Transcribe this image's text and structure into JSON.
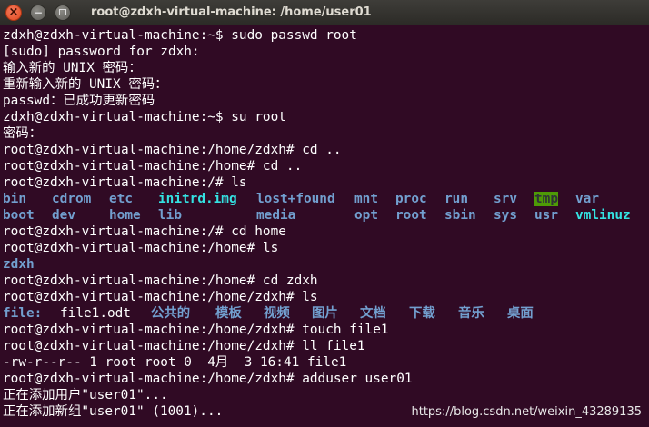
{
  "titlebar": {
    "title": "root@zdxh-virtual-machine: /home/user01",
    "close_glyph": "×",
    "minimize_glyph": "−"
  },
  "colors": {
    "background": "#300a24",
    "text": "#ffffff",
    "directory": "#729fcf",
    "symlink": "#34e2e2",
    "sticky_bg": "#4e9a06"
  },
  "terminal": {
    "lines_a": [
      "zdxh@zdxh-virtual-machine:~$ sudo passwd root",
      "[sudo] password for zdxh:",
      "输入新的 UNIX 密码：",
      "重新输入新的 UNIX 密码：",
      "passwd：已成功更新密码",
      "zdxh@zdxh-virtual-machine:~$ su root",
      "密码：",
      "root@zdxh-virtual-machine:/home/zdxh# cd ..",
      "root@zdxh-virtual-machine:/home# cd ..",
      "root@zdxh-virtual-machine:/# ls"
    ],
    "ls_root_row1": [
      "bin",
      "cdrom",
      "etc",
      "initrd.img",
      "lost+found",
      "mnt",
      "proc",
      "run",
      "srv",
      "tmp",
      "var"
    ],
    "ls_root_row2": [
      "boot",
      "dev",
      "home",
      "lib",
      "media",
      "opt",
      "root",
      "sbin",
      "sys",
      "usr",
      "vmlinuz"
    ],
    "lines_b": [
      "root@zdxh-virtual-machine:/# cd home",
      "root@zdxh-virtual-machine:/home# ls"
    ],
    "ls_home": "zdxh",
    "lines_c": [
      "root@zdxh-virtual-machine:/home# cd zdxh",
      "root@zdxh-virtual-machine:/home/zdxh# ls"
    ],
    "ls_zdxh": {
      "file_dir": "file:",
      "file_odt": "file1.odt",
      "dirs": [
        "公共的",
        "模板",
        "视频",
        "图片",
        "文档",
        "下载",
        "音乐",
        "桌面"
      ]
    },
    "lines_d": [
      "root@zdxh-virtual-machine:/home/zdxh# touch file1",
      "root@zdxh-virtual-machine:/home/zdxh# ll file1",
      "-rw-r--r-- 1 root root 0  4月  3 16:41 file1",
      "root@zdxh-virtual-machine:/home/zdxh# adduser user01",
      "正在添加用户\"user01\"...",
      "正在添加新组\"user01\" (1001)..."
    ]
  },
  "watermark": "https://blog.csdn.net/weixin_43289135"
}
